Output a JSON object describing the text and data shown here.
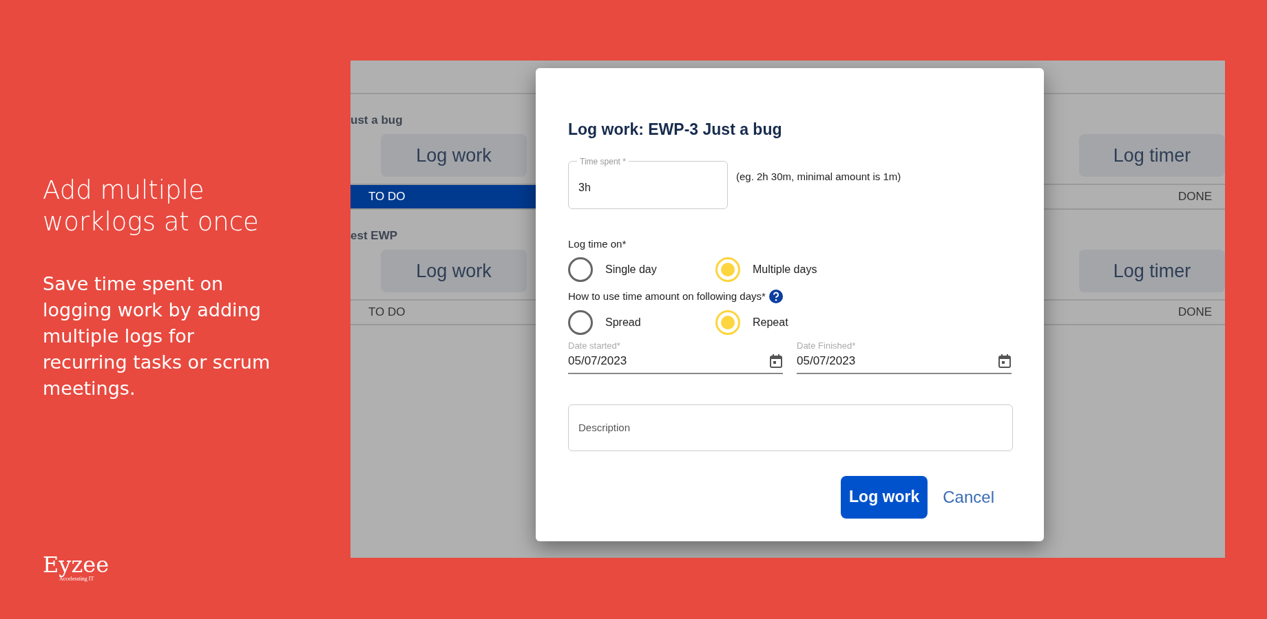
{
  "slide": {
    "heading": "Add multiple worklogs at once",
    "body": "Save time spent on logging work by adding multiple logs for recurring tasks or scrum meetings.",
    "logo": {
      "name": "Eyzee",
      "tagline": "Accelerating IT"
    }
  },
  "background_app": {
    "rows": [
      {
        "title": "ust a bug",
        "buttons": [
          "Log work",
          "Log timer"
        ],
        "status_left": "TO DO",
        "status_right": "DONE",
        "selected": true
      },
      {
        "title": "est EWP",
        "buttons": [
          "Log work",
          "Log timer"
        ],
        "status_left": "TO DO",
        "status_right": "DONE",
        "selected": false
      }
    ]
  },
  "dialog": {
    "title": "Log work: EWP-3 Just a bug",
    "time_spent": {
      "label": "Time spent *",
      "value": "3h",
      "hint": "(eg. 2h 30m, minimal amount is 1m)"
    },
    "radio_groups": [
      {
        "label": "Log time on*",
        "help": false,
        "options": [
          {
            "label": "Single day",
            "selected": false
          },
          {
            "label": "Multiple days",
            "selected": true
          }
        ]
      },
      {
        "label": "How to use time amount on following days*",
        "help": true,
        "options": [
          {
            "label": "Spread",
            "selected": false
          },
          {
            "label": "Repeat",
            "selected": true
          }
        ]
      }
    ],
    "dates": [
      {
        "label": "Date started*",
        "value": "05/07/2023"
      },
      {
        "label": "Date Finished*",
        "value": "05/07/2023"
      }
    ],
    "description": {
      "placeholder": "Description"
    },
    "buttons": [
      {
        "label": "Log work",
        "kind": "primary"
      },
      {
        "label": "Cancel",
        "kind": "link"
      }
    ]
  }
}
